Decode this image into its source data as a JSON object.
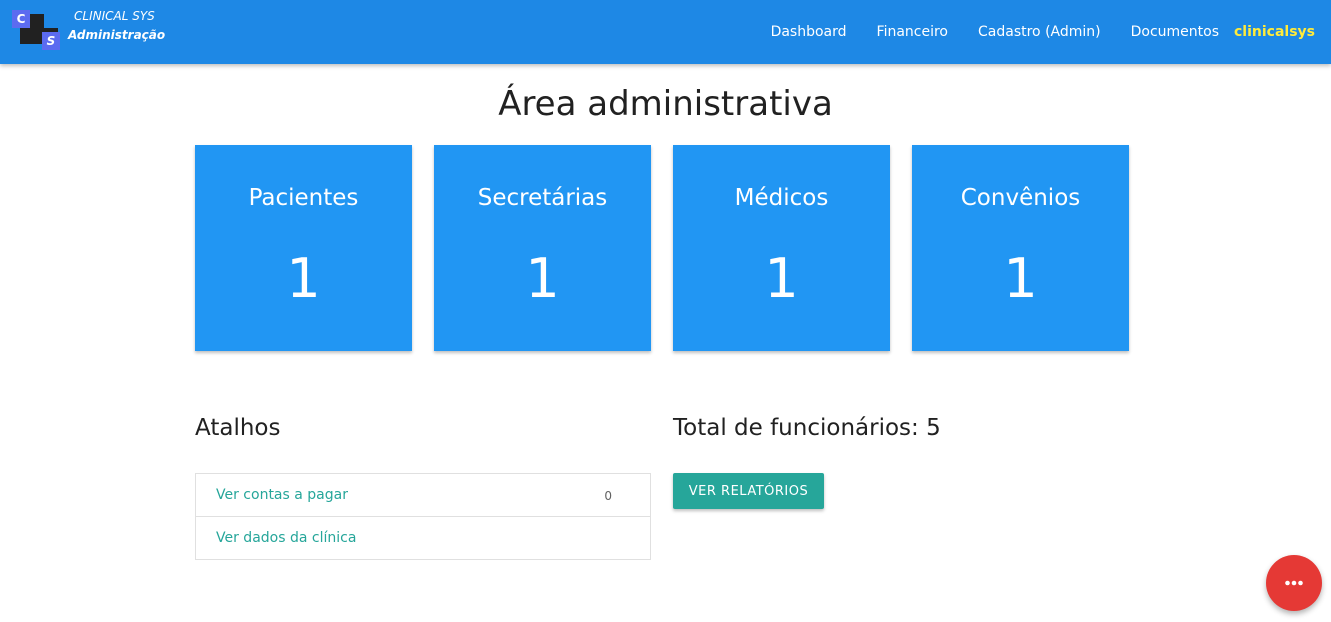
{
  "navbar": {
    "brand_letter_c": "C",
    "brand_letter_s": "S",
    "brand_title": "CLINICAL SYS",
    "brand_subtitle": "Administração",
    "links": [
      "Dashboard",
      "Financeiro",
      "Cadastro (Admin)",
      "Documentos"
    ],
    "user": "clinicalsys",
    "color": "#1e88e5",
    "user_color": "#ffeb3b"
  },
  "main": {
    "title": "Área administrativa",
    "cards": [
      {
        "label": "Pacientes",
        "count": "1"
      },
      {
        "label": "Secretárias",
        "count": "1"
      },
      {
        "label": "Médicos",
        "count": "1"
      },
      {
        "label": "Convênios",
        "count": "1"
      }
    ],
    "card_color": "#2196f3"
  },
  "shortcuts": {
    "title": "Atalhos",
    "items": [
      {
        "label": "Ver contas a pagar",
        "badge": "0"
      },
      {
        "label": "Ver dados da clínica",
        "badge": ""
      }
    ],
    "link_color": "#26a69a"
  },
  "employees": {
    "total_label": "Total de funcionários: 5",
    "reports_button": "VER RELATÓRIOS",
    "button_color": "#26a69a"
  },
  "fab": {
    "icon": "more-horiz-icon",
    "color": "#e53935"
  }
}
